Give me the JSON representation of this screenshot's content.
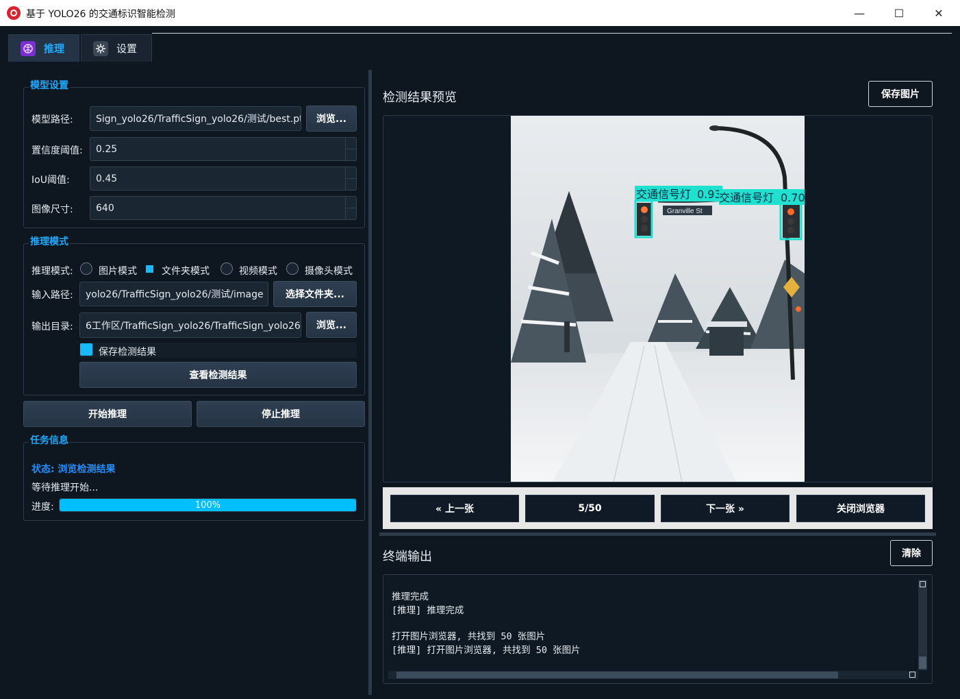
{
  "window": {
    "title": "基于 YOLO26 的交通标识智能检测",
    "minimize": "—",
    "maximize": "☐",
    "close": "✕"
  },
  "tabs": [
    {
      "label": "推理",
      "icon": "brain-icon",
      "active": true
    },
    {
      "label": "设置",
      "icon": "gear-icon",
      "active": false
    }
  ],
  "model_settings": {
    "title": "模型设置",
    "model_path_label": "模型路径:",
    "model_path_value": "Sign_yolo26/TrafficSign_yolo26/测试/best.pt",
    "browse_label": "浏览...",
    "conf_label": "置信度阈值:",
    "conf_value": "0.25",
    "iou_label": "IoU阈值:",
    "iou_value": "0.45",
    "imgsz_label": "图像尺寸:",
    "imgsz_value": "640"
  },
  "inference_mode": {
    "title": "推理模式",
    "mode_label": "推理模式:",
    "modes": [
      "图片模式",
      "文件夹模式",
      "视频模式",
      "摄像头模式"
    ],
    "selected_mode": "文件夹模式",
    "input_label": "输入路径:",
    "input_value": "yolo26/TrafficSign_yolo26/测试/image",
    "select_folder_label": "选择文件夹...",
    "output_label": "输出目录:",
    "output_value": "6工作区/TrafficSign_yolo26/TrafficSign_yolo26",
    "browse_label": "浏览...",
    "save_results_label": "保存检测结果",
    "save_results_checked": true,
    "view_results_label": "查看检测结果"
  },
  "actions": {
    "start_label": "开始推理",
    "stop_label": "停止推理"
  },
  "task_info": {
    "title": "任务信息",
    "status": "状态: 浏览检测结果",
    "message": "等待推理开始...",
    "progress_label": "进度:",
    "progress_value": 1.0,
    "progress_text": "100%"
  },
  "preview": {
    "title": "检测结果预览",
    "save_label": "保存图片",
    "detections": [
      {
        "label": "交通信号灯",
        "score": "0.93"
      },
      {
        "label": "交通信号灯",
        "score": "0.70"
      }
    ],
    "street_sign": "Granville St"
  },
  "browser_nav": {
    "prev_label": "« 上一张",
    "counter": "5/50",
    "next_label": "下一张 »",
    "close_label": "关闭浏览器"
  },
  "terminal": {
    "title": "终端输出",
    "clear_label": "清除",
    "lines": [
      "推理完成",
      "[推理] 推理完成",
      "",
      "打开图片浏览器, 共找到 50 张图片",
      "[推理] 打开图片浏览器, 共找到 50 张图片"
    ]
  },
  "colors": {
    "background": "#0e1620",
    "accent": "#19b8ff",
    "group_title": "#1fa9ff",
    "detection_box": "#20e0d0"
  }
}
